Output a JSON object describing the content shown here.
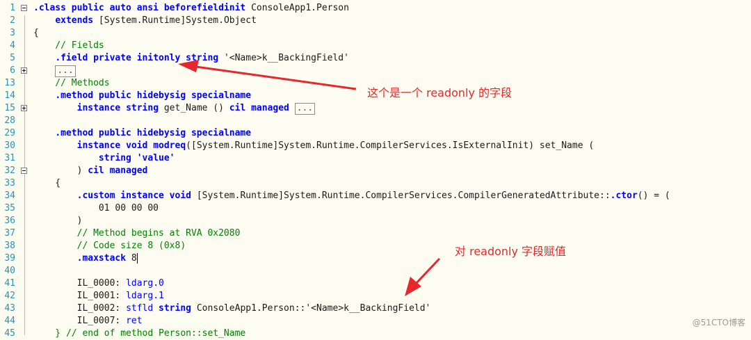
{
  "annotations": {
    "readonly_field": "这个是一个 readonly 的字段",
    "assign_readonly": "对 readonly 字段赋值"
  },
  "watermark": "@51CTO博客",
  "colors": {
    "arrow": "#e6282c",
    "keyword": "#0000ff",
    "comment": "#008000"
  },
  "lines": [
    {
      "n": "1",
      "fold": "minus",
      "tokens": [
        [
          ".class public auto ansi beforefieldinit",
          "kw"
        ],
        [
          " ConsoleApp1.Person",
          "tx"
        ]
      ]
    },
    {
      "n": "2",
      "tokens": [
        [
          "    ",
          "tx"
        ],
        [
          "extends",
          "kw"
        ],
        [
          " [System.Runtime]System.Object",
          "tx"
        ]
      ]
    },
    {
      "n": "3",
      "tokens": [
        [
          "{",
          "tx"
        ]
      ]
    },
    {
      "n": "4",
      "tokens": [
        [
          "    // Fields",
          "cm"
        ]
      ]
    },
    {
      "n": "5",
      "tokens": [
        [
          "    ",
          "tx"
        ],
        [
          ".field private initonly string",
          "kw"
        ],
        [
          " '<Name>k__BackingField'",
          "tx"
        ]
      ]
    },
    {
      "n": "6",
      "fold": "plus",
      "tokens": [
        [
          "    ",
          "tx"
        ],
        [
          "...",
          "box"
        ]
      ]
    },
    {
      "n": "13",
      "tokens": [
        [
          "    // Methods",
          "cm"
        ]
      ]
    },
    {
      "n": "14",
      "tokens": [
        [
          "    ",
          "tx"
        ],
        [
          ".method public hidebysig specialname",
          "kw"
        ]
      ]
    },
    {
      "n": "15",
      "fold": "plus",
      "tokens": [
        [
          "        ",
          "tx"
        ],
        [
          "instance string",
          "kw"
        ],
        [
          " get_Name () ",
          "tx"
        ],
        [
          "cil managed",
          "kw"
        ],
        [
          " ",
          "tx"
        ],
        [
          "...",
          "box"
        ]
      ]
    },
    {
      "n": "28",
      "tokens": []
    },
    {
      "n": "29",
      "tokens": [
        [
          "    ",
          "tx"
        ],
        [
          ".method public hidebysig specialname",
          "kw"
        ]
      ]
    },
    {
      "n": "30",
      "tokens": [
        [
          "        ",
          "tx"
        ],
        [
          "instance void modreq",
          "kw"
        ],
        [
          "([System.Runtime]System.Runtime.CompilerServices.IsExternalInit) set_Name (",
          "tx"
        ]
      ]
    },
    {
      "n": "31",
      "tokens": [
        [
          "            ",
          "tx"
        ],
        [
          "string",
          "kw"
        ],
        [
          " 'value'",
          "kw"
        ]
      ]
    },
    {
      "n": "32",
      "fold": "minus",
      "tokens": [
        [
          "        ) ",
          "tx"
        ],
        [
          "cil managed",
          "kw"
        ]
      ]
    },
    {
      "n": "33",
      "tokens": [
        [
          "    {",
          "tx"
        ]
      ]
    },
    {
      "n": "34",
      "tokens": [
        [
          "        ",
          "tx"
        ],
        [
          ".custom instance void",
          "kw"
        ],
        [
          " [System.Runtime]System.Runtime.CompilerServices.CompilerGeneratedAttribute::",
          "tx"
        ],
        [
          ".ctor",
          "kw"
        ],
        [
          "() = (",
          "tx"
        ]
      ]
    },
    {
      "n": "35",
      "tokens": [
        [
          "            01 00 00 00",
          "tx"
        ]
      ]
    },
    {
      "n": "36",
      "tokens": [
        [
          "        )",
          "tx"
        ]
      ]
    },
    {
      "n": "37",
      "tokens": [
        [
          "        // Method begins at RVA 0x2080",
          "cm"
        ]
      ]
    },
    {
      "n": "38",
      "tokens": [
        [
          "        // Code size 8 (0x8)",
          "cm"
        ]
      ]
    },
    {
      "n": "39",
      "tokens": [
        [
          "        ",
          "tx"
        ],
        [
          ".maxstack",
          "kw"
        ],
        [
          " 8",
          "tx"
        ],
        [
          "",
          "cursor"
        ]
      ]
    },
    {
      "n": "40",
      "tokens": []
    },
    {
      "n": "41",
      "tokens": [
        [
          "        IL_0000: ",
          "tx"
        ],
        [
          "ldarg.0",
          "kwn"
        ]
      ]
    },
    {
      "n": "42",
      "tokens": [
        [
          "        IL_0001: ",
          "tx"
        ],
        [
          "ldarg.1",
          "kwn"
        ]
      ]
    },
    {
      "n": "43",
      "tokens": [
        [
          "        IL_0002: ",
          "tx"
        ],
        [
          "stfld",
          "kwn"
        ],
        [
          " ",
          "tx"
        ],
        [
          "string",
          "kw"
        ],
        [
          " ConsoleApp1.Person::'<Name>k__BackingField'",
          "tx"
        ]
      ]
    },
    {
      "n": "44",
      "tokens": [
        [
          "        IL_0007: ",
          "tx"
        ],
        [
          "ret",
          "kwn"
        ]
      ]
    },
    {
      "n": "45",
      "tokens": [
        [
          "    } // end of method Person::set_Name",
          "cm"
        ]
      ]
    }
  ]
}
